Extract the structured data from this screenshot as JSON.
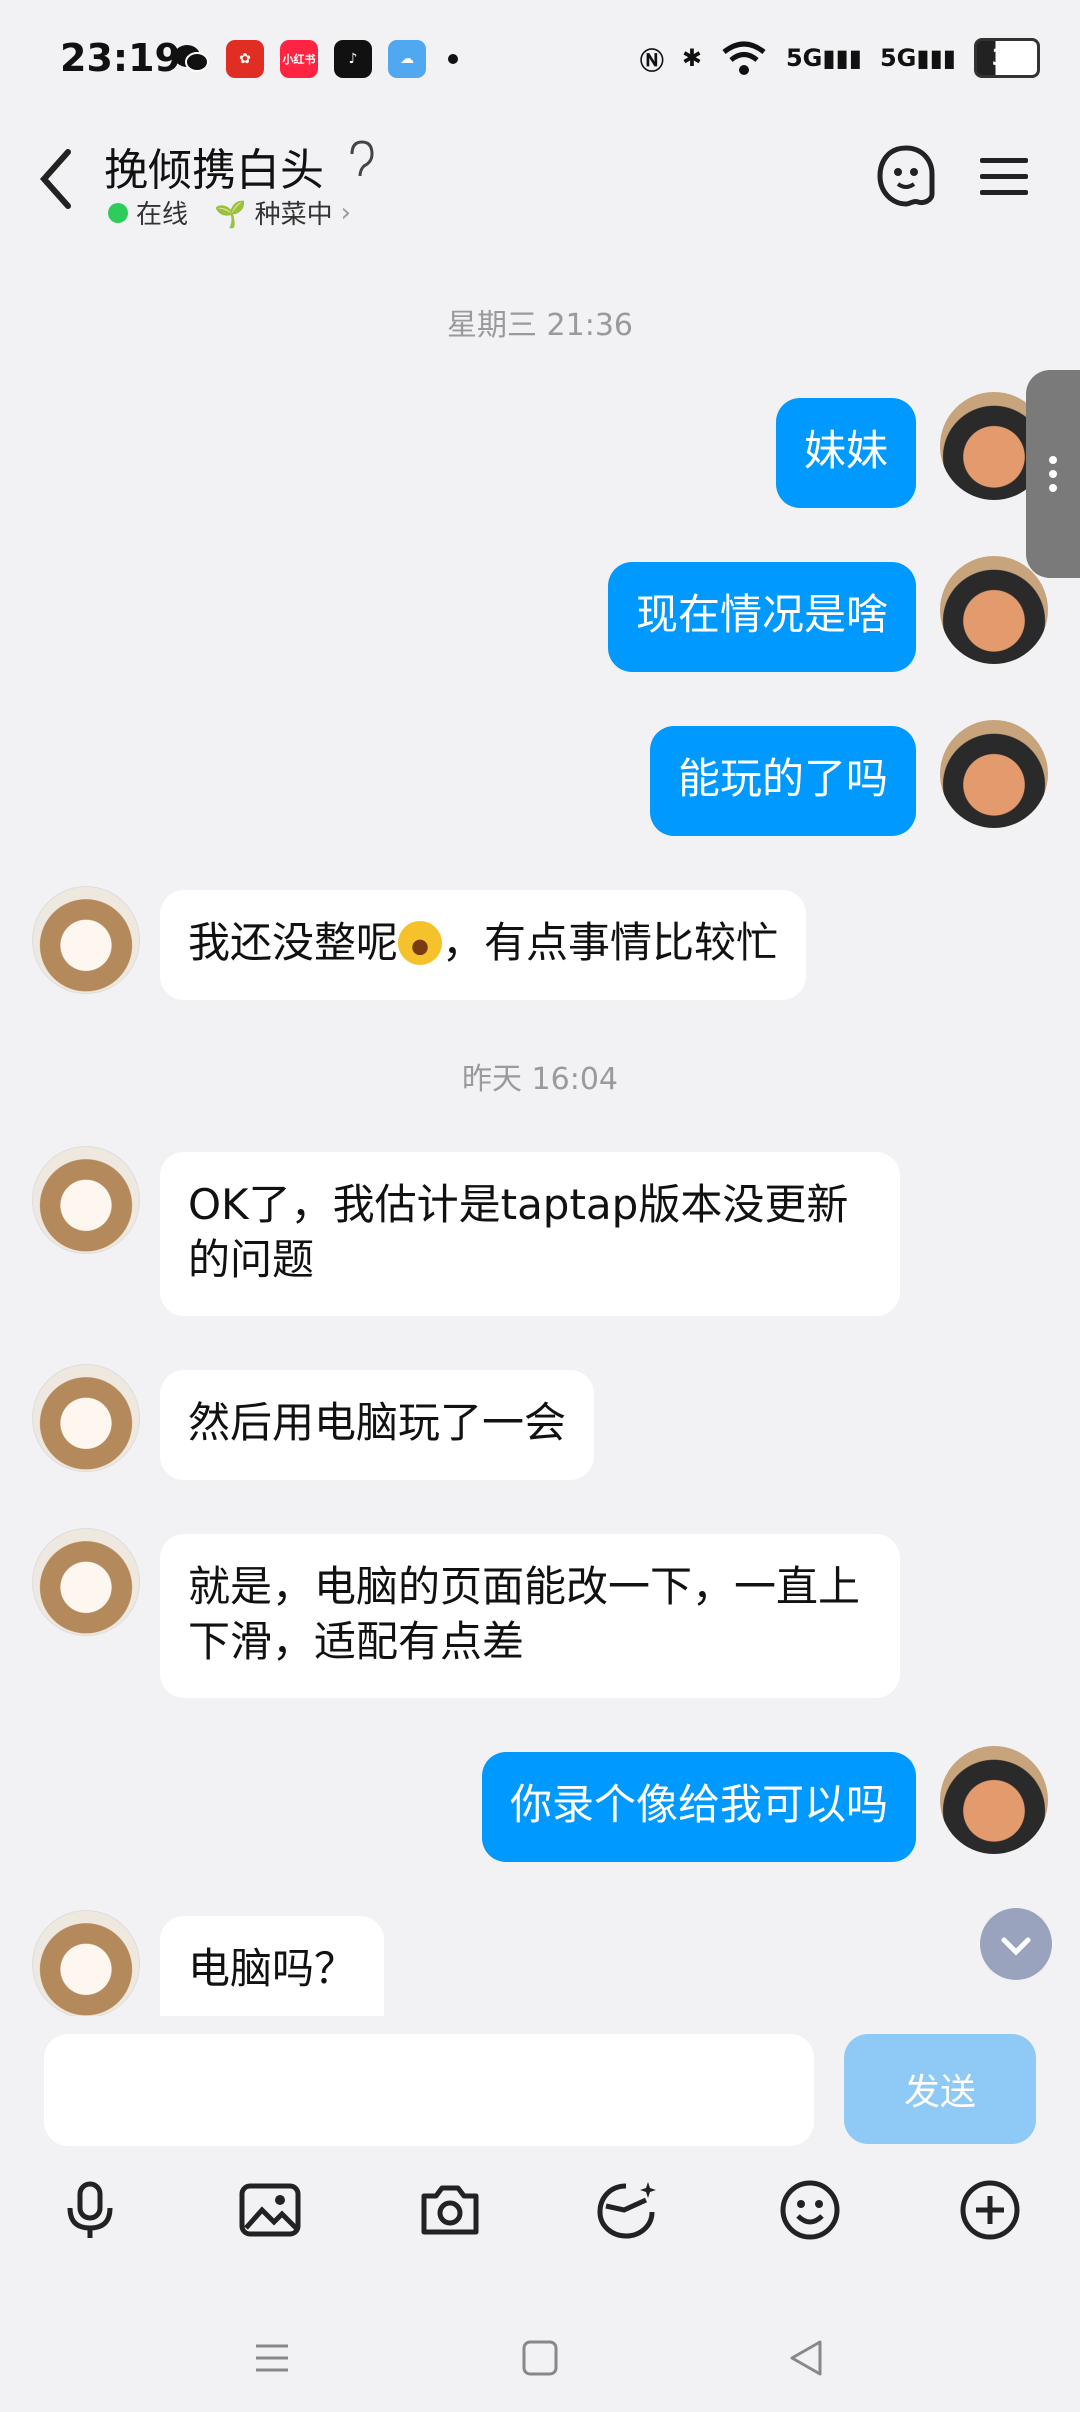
{
  "status_bar": {
    "time": "23:19",
    "apps": [
      {
        "icon": "wechat-icon",
        "color": "#111111"
      },
      {
        "icon": "pinduoduo-icon",
        "color": "#e02e24"
      },
      {
        "icon": "xiaohongshu-icon",
        "color": "#ff2442",
        "text": "小红书"
      },
      {
        "icon": "tiktok-icon",
        "color": "#111111"
      },
      {
        "icon": "weather-icon",
        "color": "#4fa8f0"
      }
    ],
    "network": "5G",
    "battery": "31"
  },
  "header": {
    "title": "挽倾携白头",
    "online_status": "在线",
    "activity": "🌱 种菜中"
  },
  "messages": [
    {
      "type": "time",
      "text": "星期三 21:36"
    },
    {
      "type": "out",
      "text": "妹妹"
    },
    {
      "type": "out",
      "text": "现在情况是啥"
    },
    {
      "type": "out",
      "text": "能玩的了吗"
    },
    {
      "type": "in",
      "text_before": "我还没整呢",
      "text_after": "，有点事情比较忙",
      "emoji": "sticker-emoji"
    },
    {
      "type": "time",
      "text": "昨天 16:04"
    },
    {
      "type": "in",
      "text": "OK了，我估计是taptap版本没更新的问题"
    },
    {
      "type": "in",
      "text": "然后用电脑玩了一会"
    },
    {
      "type": "in",
      "text": "就是，电脑的页面能改一下，一直上下滑，适配有点差"
    },
    {
      "type": "out",
      "text": "你录个像给我可以吗"
    },
    {
      "type": "in",
      "text": "电脑吗？"
    }
  ],
  "input": {
    "value": "",
    "send_label": "发送"
  },
  "toolbar": [
    "microphone-icon",
    "image-icon",
    "camera-icon",
    "gif-face-icon",
    "emoji-smile-icon",
    "plus-icon"
  ],
  "colors": {
    "accent": "#0099ff",
    "background": "#f2f2f5",
    "send_disabled": "#8fcaf6"
  }
}
